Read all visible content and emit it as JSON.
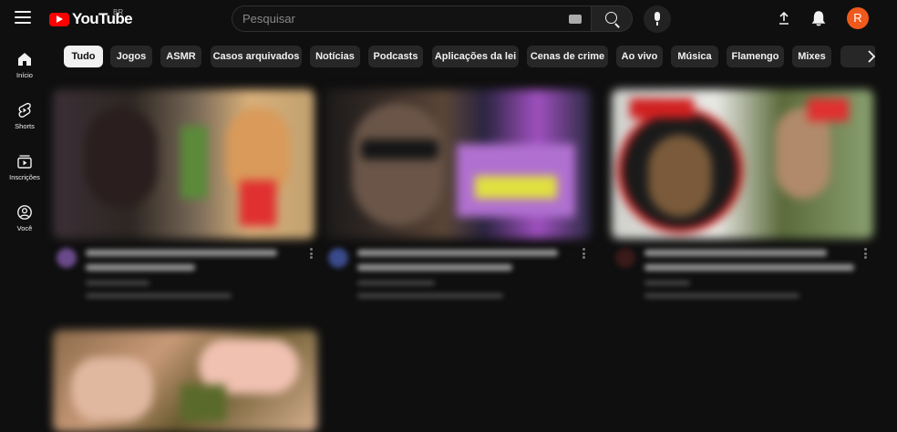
{
  "app": {
    "logo_text": "YouTube",
    "region": "BR",
    "accent_color": "#ff0000",
    "avatar_color": "#ef5a1c"
  },
  "search": {
    "placeholder": "Pesquisar",
    "keyboard_icon": "keyboard-icon",
    "search_icon": "search-icon",
    "mic_icon": "microphone-icon"
  },
  "header": {
    "upload_icon": "upload-icon",
    "bell_icon": "bell-icon",
    "avatar_letter": "R"
  },
  "sidebar": {
    "items": [
      {
        "label": "Início",
        "icon": "home-icon"
      },
      {
        "label": "Shorts",
        "icon": "shorts-icon"
      },
      {
        "label": "Inscrições",
        "icon": "subscriptions-icon"
      },
      {
        "label": "Você",
        "icon": "user-icon"
      }
    ]
  },
  "chips": {
    "items": [
      {
        "label": "Tudo",
        "active": true
      },
      {
        "label": "Jogos",
        "active": false
      },
      {
        "label": "ASMR",
        "active": false
      },
      {
        "label": "Casos arquivados",
        "active": false
      },
      {
        "label": "Notícias",
        "active": false
      },
      {
        "label": "Podcasts",
        "active": false
      },
      {
        "label": "Aplicações da lei",
        "active": false
      },
      {
        "label": "Cenas de crime",
        "active": false
      },
      {
        "label": "Ao vivo",
        "active": false
      },
      {
        "label": "Música",
        "active": false
      },
      {
        "label": "Flamengo",
        "active": false
      },
      {
        "label": "Mixes",
        "active": false
      }
    ],
    "next_icon": "chevron-right-icon"
  },
  "videos": {
    "note_colors": [
      "#3a2f3a",
      "#2e2a33",
      "#3a3636",
      "#5a4a40"
    ]
  }
}
